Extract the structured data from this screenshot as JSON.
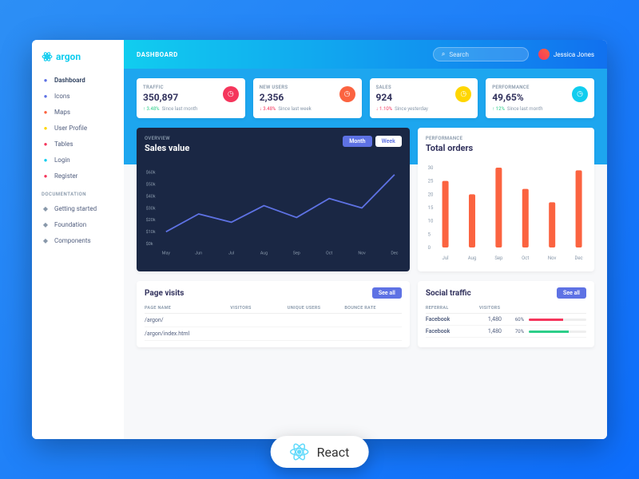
{
  "brand": "argon",
  "header": {
    "title": "DASHBOARD",
    "search_placeholder": "Search",
    "user_name": "Jessica Jones"
  },
  "sidebar": {
    "items": [
      {
        "label": "Dashboard",
        "icon": "tv",
        "color": "#5e72e4"
      },
      {
        "label": "Icons",
        "icon": "planet",
        "color": "#5e72e4"
      },
      {
        "label": "Maps",
        "icon": "pin",
        "color": "#fb6340"
      },
      {
        "label": "User Profile",
        "icon": "user",
        "color": "#ffd600"
      },
      {
        "label": "Tables",
        "icon": "list",
        "color": "#f5365c"
      },
      {
        "label": "Login",
        "icon": "key",
        "color": "#11cdef"
      },
      {
        "label": "Register",
        "icon": "circle",
        "color": "#f5365c"
      }
    ],
    "section": "DOCUMENTATION",
    "docs": [
      {
        "label": "Getting started",
        "icon": "rocket"
      },
      {
        "label": "Foundation",
        "icon": "palette"
      },
      {
        "label": "Components",
        "icon": "ui"
      }
    ]
  },
  "stats": [
    {
      "label": "TRAFFIC",
      "value": "350,897",
      "delta": "3.48%",
      "dir": "up",
      "since": "Since last month",
      "iconBg": "#f5365c"
    },
    {
      "label": "NEW USERS",
      "value": "2,356",
      "delta": "3.48%",
      "dir": "down",
      "since": "Since last week",
      "iconBg": "#fb6340"
    },
    {
      "label": "SALES",
      "value": "924",
      "delta": "1.10%",
      "dir": "down",
      "since": "Since yesterday",
      "iconBg": "#ffd600"
    },
    {
      "label": "PERFORMANCE",
      "value": "49,65%",
      "delta": "12%",
      "dir": "up",
      "since": "Since last month",
      "iconBg": "#11cdef"
    }
  ],
  "sales_chart": {
    "overline": "OVERVIEW",
    "title": "Sales value",
    "tab_month": "Month",
    "tab_week": "Week"
  },
  "orders_chart": {
    "overline": "PERFORMANCE",
    "title": "Total orders"
  },
  "page_visits": {
    "title": "Page visits",
    "seeall": "See all",
    "cols": [
      "PAGE NAME",
      "VISITORS",
      "UNIQUE USERS",
      "BOUNCE RATE"
    ],
    "rows": [
      {
        "page": "/argon/"
      },
      {
        "page": "/argon/index.html"
      }
    ]
  },
  "social": {
    "title": "Social traffic",
    "seeall": "See all",
    "cols": [
      "REFERRAL",
      "VISITORS"
    ],
    "rows": [
      {
        "name": "Facebook",
        "visitors": "1,480",
        "pct": 60,
        "color": "#f5365c"
      },
      {
        "name": "Facebook",
        "visitors": "1,480",
        "pct": 70,
        "color": "#2dce89"
      }
    ]
  },
  "badge": "React",
  "chart_data": [
    {
      "type": "line",
      "title": "Sales value",
      "ylabel": "",
      "xlabel": "",
      "ylim": [
        0,
        60
      ],
      "y_ticks": [
        "$0k",
        "$10k",
        "$20k",
        "$30k",
        "$40k",
        "$50k",
        "$60k"
      ],
      "categories": [
        "May",
        "Jun",
        "Jul",
        "Aug",
        "Sep",
        "Oct",
        "Nov",
        "Dec"
      ],
      "values": [
        10,
        25,
        18,
        32,
        22,
        38,
        30,
        58
      ]
    },
    {
      "type": "bar",
      "title": "Total orders",
      "ylim": [
        0,
        30
      ],
      "y_ticks": [
        0,
        5,
        10,
        15,
        20,
        25,
        30
      ],
      "categories": [
        "Jul",
        "Aug",
        "Sep",
        "Oct",
        "Nov",
        "Dec"
      ],
      "values": [
        25,
        20,
        30,
        22,
        17,
        29
      ]
    }
  ]
}
